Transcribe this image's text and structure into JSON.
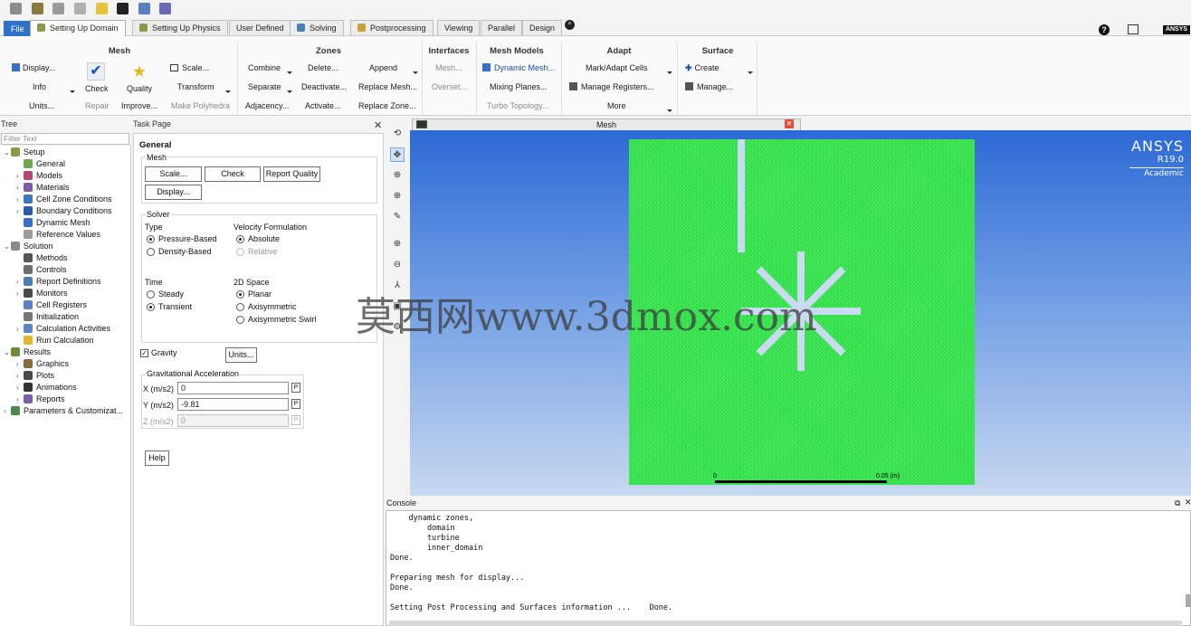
{
  "tabs": [
    {
      "label": "File",
      "kind": "file"
    },
    {
      "label": "Setting Up Domain",
      "kind": "active"
    },
    {
      "label": "Setting Up Physics",
      "kind": "normal"
    },
    {
      "label": "User Defined",
      "kind": "normal"
    },
    {
      "label": "Solving",
      "kind": "normal"
    },
    {
      "label": "Postprocessing",
      "kind": "normal"
    },
    {
      "label": "Viewing",
      "kind": "normal"
    },
    {
      "label": "Parallel",
      "kind": "normal"
    },
    {
      "label": "Design",
      "kind": "normal"
    }
  ],
  "brand_mini": "ANSYS",
  "ribbon": {
    "mesh": {
      "title": "Mesh",
      "display": "Display...",
      "info": "Info",
      "units": "Units...",
      "check": "Check",
      "repair": "Repair",
      "quality": "Quality",
      "improve": "Improve...",
      "scale": "Scale...",
      "transform": "Transform",
      "make_polyhedra": "Make Polyhedra"
    },
    "zones": {
      "title": "Zones",
      "combine": "Combine",
      "separate": "Separate",
      "adjacency": "Adjacency...",
      "delete": "Delete...",
      "deactivate": "Deactivate...",
      "activate": "Activate...",
      "append": "Append",
      "replace_mesh": "Replace Mesh...",
      "replace_zone": "Replace Zone..."
    },
    "interfaces": {
      "title": "Interfaces",
      "mesh": "Mesh...",
      "overset": "Overset..."
    },
    "mesh_models": {
      "title": "Mesh Models",
      "dynamic_mesh": "Dynamic Mesh...",
      "mixing_planes": "Mixing Planes...",
      "turbo_topology": "Turbo Topology..."
    },
    "adapt": {
      "title": "Adapt",
      "mark_adapt": "Mark/Adapt Cells",
      "manage_registers": "Manage Registers...",
      "more": "More"
    },
    "surface": {
      "title": "Surface",
      "create": "Create",
      "manage": "Manage..."
    }
  },
  "tree": {
    "header": "Tree",
    "filter_placeholder": "Filter Text",
    "items": [
      {
        "label": "Setup",
        "level": 0,
        "exp": "v",
        "color": "#8a9a4a"
      },
      {
        "label": "General",
        "level": 1,
        "exp": "",
        "color": "#6aa84f"
      },
      {
        "label": "Models",
        "level": 1,
        "exp": ">",
        "color": "#b4476b"
      },
      {
        "label": "Materials",
        "level": 1,
        "exp": ">",
        "color": "#7b5ea7"
      },
      {
        "label": "Cell Zone Conditions",
        "level": 1,
        "exp": ">",
        "color": "#3a78c2"
      },
      {
        "label": "Boundary Conditions",
        "level": 1,
        "exp": ">",
        "color": "#2f5aa8"
      },
      {
        "label": "Dynamic Mesh",
        "level": 1,
        "exp": "",
        "color": "#3a6fc7"
      },
      {
        "label": "Reference Values",
        "level": 1,
        "exp": "",
        "color": "#9c9c9c"
      },
      {
        "label": "Solution",
        "level": 0,
        "exp": "v",
        "color": "#8a8a8a"
      },
      {
        "label": "Methods",
        "level": 1,
        "exp": "",
        "color": "#555555"
      },
      {
        "label": "Controls",
        "level": 1,
        "exp": "",
        "color": "#6f6f6f"
      },
      {
        "label": "Report Definitions",
        "level": 1,
        "exp": ">",
        "color": "#4a7fb5"
      },
      {
        "label": "Monitors",
        "level": 1,
        "exp": ">",
        "color": "#4b4b4b"
      },
      {
        "label": "Cell Registers",
        "level": 1,
        "exp": "",
        "color": "#5b7fbf"
      },
      {
        "label": "Initialization",
        "level": 1,
        "exp": "",
        "color": "#777777"
      },
      {
        "label": "Calculation Activities",
        "level": 1,
        "exp": ">",
        "color": "#5a86c4"
      },
      {
        "label": "Run Calculation",
        "level": 1,
        "exp": "",
        "color": "#e0b72a"
      },
      {
        "label": "Results",
        "level": 0,
        "exp": "v",
        "color": "#6f8a3a"
      },
      {
        "label": "Graphics",
        "level": 1,
        "exp": ">",
        "color": "#8a6a3a"
      },
      {
        "label": "Plots",
        "level": 1,
        "exp": ">",
        "color": "#4a4a4a"
      },
      {
        "label": "Animations",
        "level": 1,
        "exp": ">",
        "color": "#333333"
      },
      {
        "label": "Reports",
        "level": 1,
        "exp": ">",
        "color": "#7a5ea8"
      },
      {
        "label": "Parameters & Customizat...",
        "level": 0,
        "exp": ">",
        "color": "#4a8a4a"
      }
    ]
  },
  "task": {
    "header": "Task Page",
    "title": "General",
    "mesh_label": "Mesh",
    "scale_btn": "Scale...",
    "check_btn": "Check",
    "report_quality_btn": "Report Quality",
    "display_btn": "Display...",
    "solver_label": "Solver",
    "type_label": "Type",
    "pressure_based": "Pressure-Based",
    "density_based": "Density-Based",
    "velocity_label": "Velocity Formulation",
    "absolute": "Absolute",
    "relative": "Relative",
    "time_label": "Time",
    "steady": "Steady",
    "transient": "Transient",
    "space_label": "2D Space",
    "planar": "Planar",
    "axisymmetric": "Axisymmetric",
    "axisymmetric_swirl": "Axisymmetric Swirl",
    "gravity": "Gravity",
    "units_btn": "Units...",
    "grav_label": "Gravitational Acceleration",
    "x_label": "X (m/s2)",
    "x_value": "0",
    "y_label": "Y (m/s2)",
    "y_value": "-9.81",
    "z_label": "Z (m/s2)",
    "z_value": "0",
    "p": "P",
    "help_btn": "Help"
  },
  "graphics": {
    "tab_label": "Mesh",
    "brand": "ANSYS",
    "version": "R19.0",
    "edition": "Academic",
    "scale_left": "0",
    "scale_right": "0.05 (m)",
    "mesh_color": "#31e64a"
  },
  "console": {
    "header": "Console",
    "lines": [
      "    dynamic zones,",
      "        domain",
      "        turbine",
      "        inner_domain",
      "Done.",
      "",
      "Preparing mesh for display...",
      "Done.",
      "",
      "Setting Post Processing and Surfaces information ...    Done."
    ]
  },
  "watermark": "莫西网www.3dmox.com"
}
